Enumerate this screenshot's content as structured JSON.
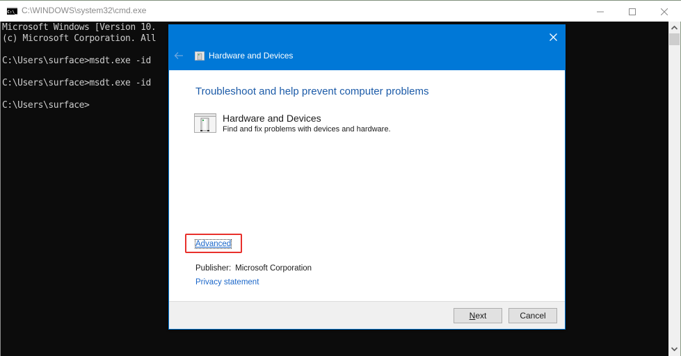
{
  "cmd": {
    "title": "C:\\WINDOWS\\system32\\cmd.exe",
    "icon_text": "C:\\_",
    "lines": [
      "Microsoft Windows [Version 10.",
      "(c) Microsoft Corporation. All",
      "",
      "C:\\Users\\surface>msdt.exe -id",
      "",
      "C:\\Users\\surface>msdt.exe -id",
      "",
      "C:\\Users\\surface>"
    ],
    "controls": {
      "minimize": "minimize",
      "maximize": "maximize",
      "close": "close"
    }
  },
  "dialog": {
    "header_title": "Hardware and Devices",
    "heading": "Troubleshoot and help prevent computer problems",
    "tool": {
      "name": "Hardware and Devices",
      "description": "Find and fix problems with devices and hardware."
    },
    "advanced_label": "Advanced",
    "publisher_label": "Publisher:",
    "publisher_value": "Microsoft Corporation",
    "privacy_label": "Privacy statement",
    "buttons": {
      "next_first": "N",
      "next_rest": "ext",
      "cancel": "Cancel"
    }
  },
  "colors": {
    "accent": "#0078d7",
    "link": "#1a66c9",
    "heading": "#1c5ba8",
    "highlight": "#e8302b",
    "console_bg": "#0c0c0c",
    "console_fg": "#cccccc"
  }
}
